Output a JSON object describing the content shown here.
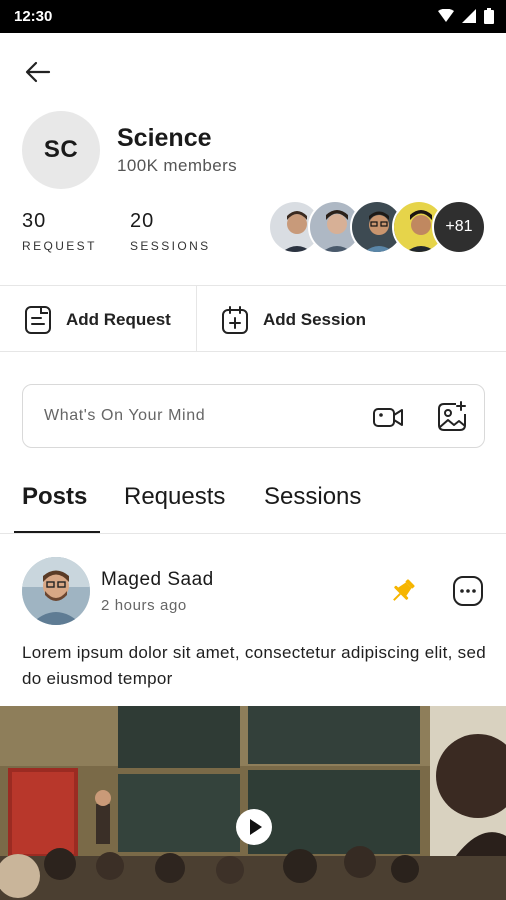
{
  "status_bar": {
    "time": "12:30"
  },
  "group": {
    "initials": "SC",
    "name": "Science",
    "members": "100K members"
  },
  "stats": [
    {
      "value": "30",
      "label": "REQUEST"
    },
    {
      "value": "20",
      "label": "SESSIONS"
    }
  ],
  "members_preview": {
    "more_count": "+81"
  },
  "actions": {
    "add_request": "Add Request",
    "add_session": "Add Session"
  },
  "composer": {
    "placeholder": "What's On Your Mind",
    "video_icon": "video-camera-icon",
    "photo_icon": "add-photo-icon"
  },
  "tabs": [
    {
      "label": "Posts",
      "active": true
    },
    {
      "label": "Requests",
      "active": false
    },
    {
      "label": "Sessions",
      "active": false
    }
  ],
  "post": {
    "author": "Maged Saad",
    "time": "2 hours ago",
    "text": "Lorem ipsum dolor sit amet, consectetur adipiscing elit, sed do eiusmod tempor",
    "pinned": true,
    "pin_color": "#F6B500"
  },
  "colors": {
    "text": "#1a1a1a",
    "divider": "#e6e6e6",
    "pin": "#F6B500"
  }
}
